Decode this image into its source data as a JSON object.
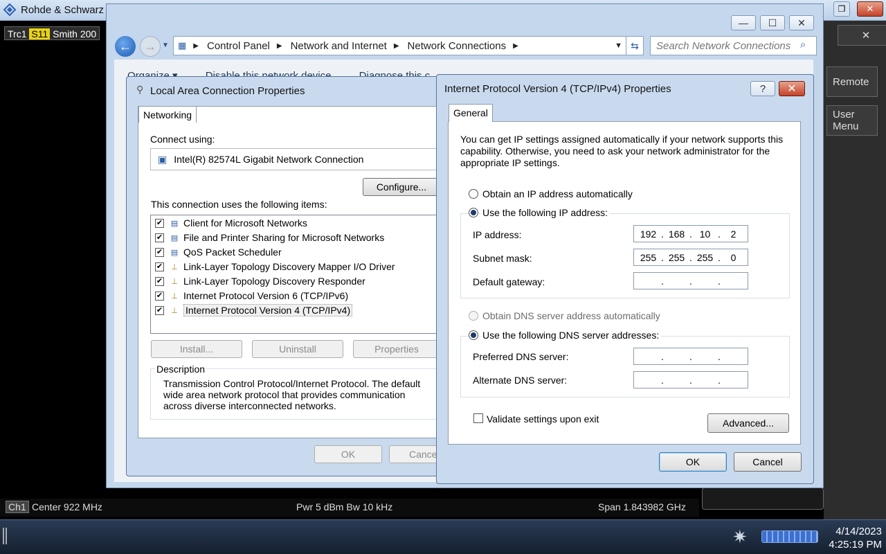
{
  "app": {
    "title": "Rohde & Schwarz",
    "trace": {
      "trc": "Trc1",
      "param": "S11",
      "format": "Smith",
      "scale": "200"
    },
    "softkeys": [
      {
        "label": "Remote"
      },
      {
        "label": "User Menu"
      }
    ],
    "status": {
      "channel": "Ch1",
      "center": "Center  922 MHz",
      "power": "Pwr  5 dBm  Bw  10 kHz",
      "span": "Span  1.843982 GHz"
    },
    "clock": {
      "date": "4/14/2023",
      "time": "4:25:19 PM"
    }
  },
  "explorer": {
    "breadcrumb": [
      "Control Panel",
      "Network and Internet",
      "Network Connections"
    ],
    "search_placeholder": "Search Network Connections",
    "toolbar_partial": [
      "Organize ▾",
      "Disable this network device",
      "Diagnose this c"
    ]
  },
  "lan_dialog": {
    "title": "Local Area Connection Properties",
    "tab": "Networking",
    "connect_using_label": "Connect using:",
    "adapter": "Intel(R) 82574L Gigabit Network Connection",
    "configure_btn": "Configure...",
    "items_label": "This connection uses the following items:",
    "items": [
      {
        "label": "Client for Microsoft Networks",
        "checked": true,
        "icon": "network-client-icon"
      },
      {
        "label": "File and Printer Sharing for Microsoft Networks",
        "checked": true,
        "icon": "network-service-icon"
      },
      {
        "label": "QoS Packet Scheduler",
        "checked": true,
        "icon": "network-service-icon"
      },
      {
        "label": "Link-Layer Topology Discovery Mapper I/O Driver",
        "checked": true,
        "icon": "protocol-icon"
      },
      {
        "label": "Link-Layer Topology Discovery Responder",
        "checked": true,
        "icon": "protocol-icon"
      },
      {
        "label": "Internet Protocol Version 6 (TCP/IPv6)",
        "checked": true,
        "icon": "protocol-icon"
      },
      {
        "label": "Internet Protocol Version 4 (TCP/IPv4)",
        "checked": true,
        "icon": "protocol-icon"
      }
    ],
    "install_btn": "Install...",
    "uninstall_btn": "Uninstall",
    "properties_btn": "Properties",
    "description_label": "Description",
    "description_text": "Transmission Control Protocol/Internet Protocol. The default wide area network protocol that provides communication across diverse interconnected networks.",
    "ok_btn": "OK",
    "cancel_btn": "Cance"
  },
  "ipv4_dialog": {
    "title": "Internet Protocol Version 4 (TCP/IPv4) Properties",
    "tab": "General",
    "intro": "You can get IP settings assigned automatically if your network supports this capability. Otherwise, you need to ask your network administrator for the appropriate IP settings.",
    "auto_ip_label": "Obtain an IP address automatically",
    "manual_ip_label": "Use the following IP address:",
    "ip_label": "IP address:",
    "ip_value": [
      "192",
      "168",
      "10",
      "2"
    ],
    "mask_label": "Subnet mask:",
    "mask_value": [
      "255",
      "255",
      "255",
      "0"
    ],
    "gateway_label": "Default gateway:",
    "gateway_value": [
      "",
      "",
      "",
      ""
    ],
    "auto_dns_label": "Obtain DNS server address automatically",
    "manual_dns_label": "Use the following DNS server addresses:",
    "pref_dns_label": "Preferred DNS server:",
    "pref_dns_value": [
      "",
      "",
      "",
      ""
    ],
    "alt_dns_label": "Alternate DNS server:",
    "alt_dns_value": [
      "",
      "",
      "",
      ""
    ],
    "validate_label": "Validate settings upon exit",
    "advanced_btn": "Advanced...",
    "ok_btn": "OK",
    "cancel_btn": "Cancel",
    "help_glyph": "?",
    "close_glyph": "✕"
  }
}
